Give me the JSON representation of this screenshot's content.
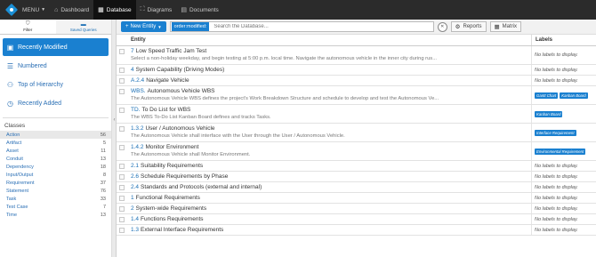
{
  "topbar": {
    "menu_label": "MENU",
    "items": [
      {
        "label": "Dashboard",
        "icon": "dashboard-icon",
        "glyph": "⌂",
        "active": false
      },
      {
        "label": "Database",
        "icon": "database-icon",
        "glyph": "▦",
        "active": true
      },
      {
        "label": "Diagrams",
        "icon": "diagrams-icon",
        "glyph": "⛶",
        "active": false
      },
      {
        "label": "Documents",
        "icon": "documents-icon",
        "glyph": "▤",
        "active": false
      }
    ]
  },
  "sidebar": {
    "tabs": [
      {
        "label": "Filter",
        "icon": "filter-icon"
      },
      {
        "label": "Saved Queries",
        "icon": "saved-queries-icon"
      }
    ],
    "quick_items": [
      {
        "label": "Recently Modified",
        "icon": "calendar-icon",
        "active": true
      },
      {
        "label": "Numbered",
        "icon": "numbered-list-icon",
        "active": false
      },
      {
        "label": "Top of Hierarchy",
        "icon": "hierarchy-icon",
        "active": false
      },
      {
        "label": "Recently Added",
        "icon": "clock-icon",
        "active": false
      }
    ],
    "classes_heading": "Classes",
    "classes": [
      {
        "name": "Action",
        "count": "56"
      },
      {
        "name": "Artifact",
        "count": "5"
      },
      {
        "name": "Asset",
        "count": "11"
      },
      {
        "name": "Conduit",
        "count": "13"
      },
      {
        "name": "Dependency",
        "count": "18"
      },
      {
        "name": "Input/Output",
        "count": "8"
      },
      {
        "name": "Requirement",
        "count": "37"
      },
      {
        "name": "Statement",
        "count": "76"
      },
      {
        "name": "Task",
        "count": "33"
      },
      {
        "name": "Test Case",
        "count": "7"
      },
      {
        "name": "Time",
        "count": "13"
      }
    ]
  },
  "toolbar": {
    "new_entity_label": "New Entity",
    "filter_chip": "order:modified:",
    "search_placeholder": "Search the Database...",
    "reports_label": "Reports",
    "matrix_label": "Matrix"
  },
  "table": {
    "col_entity": "Entity",
    "col_labels": "Labels",
    "rows": [
      {
        "num": "7",
        "title": "Low Speed Traffic Jam Test",
        "desc": "Select a non-holiday weekday, and begin testing at 5:00 p.m. local time. Navigate the autonomous vehicle in the inner city during rus...",
        "labels": [],
        "no_labels": "No labels to display."
      },
      {
        "num": "4",
        "title": "System Capability (Driving Modes)",
        "desc": "",
        "labels": [],
        "no_labels": "No labels to display."
      },
      {
        "num": "A.2.4",
        "title": "Navigate Vehicle",
        "desc": "",
        "labels": [],
        "no_labels": "No labels to display."
      },
      {
        "num": "WBS.",
        "title": "Autonomous Vehicle WBS",
        "desc": "The Autonomous Vehicle WBS defines the project's Work Breakdown Structure and schedule to develop and test the Autonomous Ve...",
        "labels": [
          "Gantt Chart",
          "Kanban Board"
        ],
        "no_labels": ""
      },
      {
        "num": "TD.",
        "title": "To Do List for WBS",
        "desc": "The WBS To-Do List Kanban Board defines and tracks Tasks.",
        "labels": [
          "Kanban Board"
        ],
        "no_labels": ""
      },
      {
        "num": "1.3.2",
        "title": "User / Autonomous Vehicle",
        "desc": "The Autonomous Vehicle shall interface with the User through the User / Autonomous Vehicle.",
        "labels": [
          "Interface Requirement"
        ],
        "no_labels": ""
      },
      {
        "num": "1.4.2",
        "title": "Monitor Environment",
        "desc": "The Autonomous Vehicle shall Monitor Environment.",
        "labels": [
          "Environmental Requirement"
        ],
        "no_labels": ""
      },
      {
        "num": "2.1",
        "title": "Suitability Requirements",
        "desc": "",
        "labels": [],
        "no_labels": "No labels to display."
      },
      {
        "num": "2.6",
        "title": "Schedule Requirements by Phase",
        "desc": "",
        "labels": [],
        "no_labels": "No labels to display."
      },
      {
        "num": "2.4",
        "title": "Standards and Protocols (external and internal)",
        "desc": "",
        "labels": [],
        "no_labels": "No labels to display."
      },
      {
        "num": "1",
        "title": "Functional Requirements",
        "desc": "",
        "labels": [],
        "no_labels": "No labels to display."
      },
      {
        "num": "2",
        "title": "System-wide Requirements",
        "desc": "",
        "labels": [],
        "no_labels": "No labels to display."
      },
      {
        "num": "1.4",
        "title": "Functions Requirements",
        "desc": "",
        "labels": [],
        "no_labels": "No labels to display."
      },
      {
        "num": "1.3",
        "title": "External Interface Requirements",
        "desc": "",
        "labels": [],
        "no_labels": "No labels to display."
      }
    ]
  }
}
